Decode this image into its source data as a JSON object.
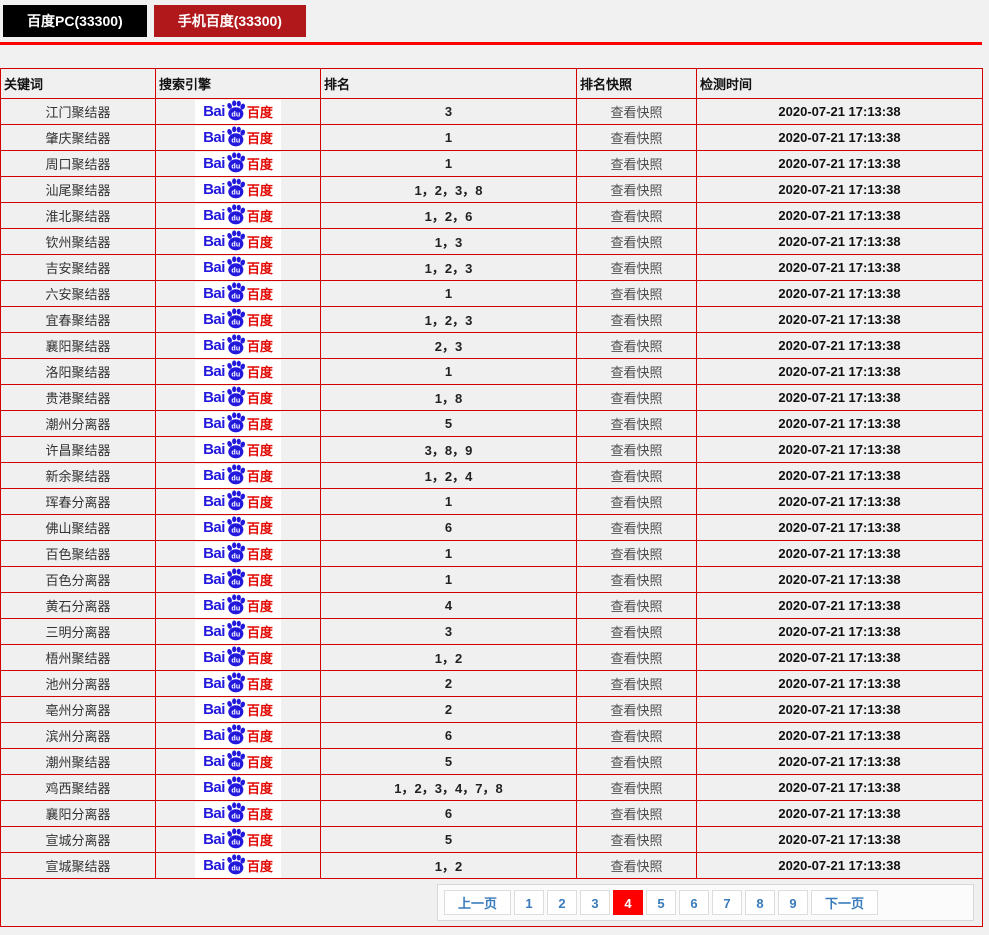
{
  "tabs": [
    {
      "label": "百度PC(33300)"
    },
    {
      "label": "手机百度(33300)"
    }
  ],
  "table": {
    "headers": [
      "关键词",
      "搜索引擎",
      "排名",
      "排名快照",
      "检测时间"
    ],
    "engine_logo": {
      "bai": "Bai",
      "du": "du",
      "cn": "百度",
      "name": "baidu-logo"
    },
    "snapshot_label": "查看快照",
    "rows": [
      {
        "keyword": "江门聚结器",
        "rank": "3",
        "time": "2020-07-21 17:13:38"
      },
      {
        "keyword": "肇庆聚结器",
        "rank": "1",
        "time": "2020-07-21 17:13:38"
      },
      {
        "keyword": "周口聚结器",
        "rank": "1",
        "time": "2020-07-21 17:13:38"
      },
      {
        "keyword": "汕尾聚结器",
        "rank": "1，2，3，8",
        "time": "2020-07-21 17:13:38"
      },
      {
        "keyword": "淮北聚结器",
        "rank": "1，2，6",
        "time": "2020-07-21 17:13:38"
      },
      {
        "keyword": "钦州聚结器",
        "rank": "1，3",
        "time": "2020-07-21 17:13:38"
      },
      {
        "keyword": "吉安聚结器",
        "rank": "1，2，3",
        "time": "2020-07-21 17:13:38"
      },
      {
        "keyword": "六安聚结器",
        "rank": "1",
        "time": "2020-07-21 17:13:38"
      },
      {
        "keyword": "宜春聚结器",
        "rank": "1，2，3",
        "time": "2020-07-21 17:13:38"
      },
      {
        "keyword": "襄阳聚结器",
        "rank": "2，3",
        "time": "2020-07-21 17:13:38"
      },
      {
        "keyword": "洛阳聚结器",
        "rank": "1",
        "time": "2020-07-21 17:13:38"
      },
      {
        "keyword": "贵港聚结器",
        "rank": "1，8",
        "time": "2020-07-21 17:13:38"
      },
      {
        "keyword": "潮州分离器",
        "rank": "5",
        "time": "2020-07-21 17:13:38"
      },
      {
        "keyword": "许昌聚结器",
        "rank": "3，8，9",
        "time": "2020-07-21 17:13:38"
      },
      {
        "keyword": "新余聚结器",
        "rank": "1，2，4",
        "time": "2020-07-21 17:13:38"
      },
      {
        "keyword": "珲春分离器",
        "rank": "1",
        "time": "2020-07-21 17:13:38"
      },
      {
        "keyword": "佛山聚结器",
        "rank": "6",
        "time": "2020-07-21 17:13:38"
      },
      {
        "keyword": "百色聚结器",
        "rank": "1",
        "time": "2020-07-21 17:13:38"
      },
      {
        "keyword": "百色分离器",
        "rank": "1",
        "time": "2020-07-21 17:13:38"
      },
      {
        "keyword": "黄石分离器",
        "rank": "4",
        "time": "2020-07-21 17:13:38"
      },
      {
        "keyword": "三明分离器",
        "rank": "3",
        "time": "2020-07-21 17:13:38"
      },
      {
        "keyword": "梧州聚结器",
        "rank": "1，2",
        "time": "2020-07-21 17:13:38"
      },
      {
        "keyword": "池州分离器",
        "rank": "2",
        "time": "2020-07-21 17:13:38"
      },
      {
        "keyword": "亳州分离器",
        "rank": "2",
        "time": "2020-07-21 17:13:38"
      },
      {
        "keyword": "滨州分离器",
        "rank": "6",
        "time": "2020-07-21 17:13:38"
      },
      {
        "keyword": "潮州聚结器",
        "rank": "5",
        "time": "2020-07-21 17:13:38"
      },
      {
        "keyword": "鸡西聚结器",
        "rank": "1，2，3，4，7，8",
        "time": "2020-07-21 17:13:38"
      },
      {
        "keyword": "襄阳分离器",
        "rank": "6",
        "time": "2020-07-21 17:13:38"
      },
      {
        "keyword": "宣城分离器",
        "rank": "5",
        "time": "2020-07-21 17:13:38"
      },
      {
        "keyword": "宣城聚结器",
        "rank": "1，2",
        "time": "2020-07-21 17:13:38"
      }
    ]
  },
  "pagination": {
    "prev": "上一页",
    "next": "下一页",
    "pages": [
      "1",
      "2",
      "3",
      "4",
      "5",
      "6",
      "7",
      "8",
      "9"
    ],
    "active": "4"
  },
  "colors": {
    "accent_line": "#ff0000",
    "table_border": "#d40000",
    "tab_pc_bg": "#000000",
    "tab_mobile_bg": "#b0181b",
    "baidu_blue": "#2319dc",
    "baidu_red": "#e10601",
    "pager_link": "#3a7bbc",
    "pager_active_bg": "#ff0000",
    "row_bg": "#f0f0f0"
  }
}
